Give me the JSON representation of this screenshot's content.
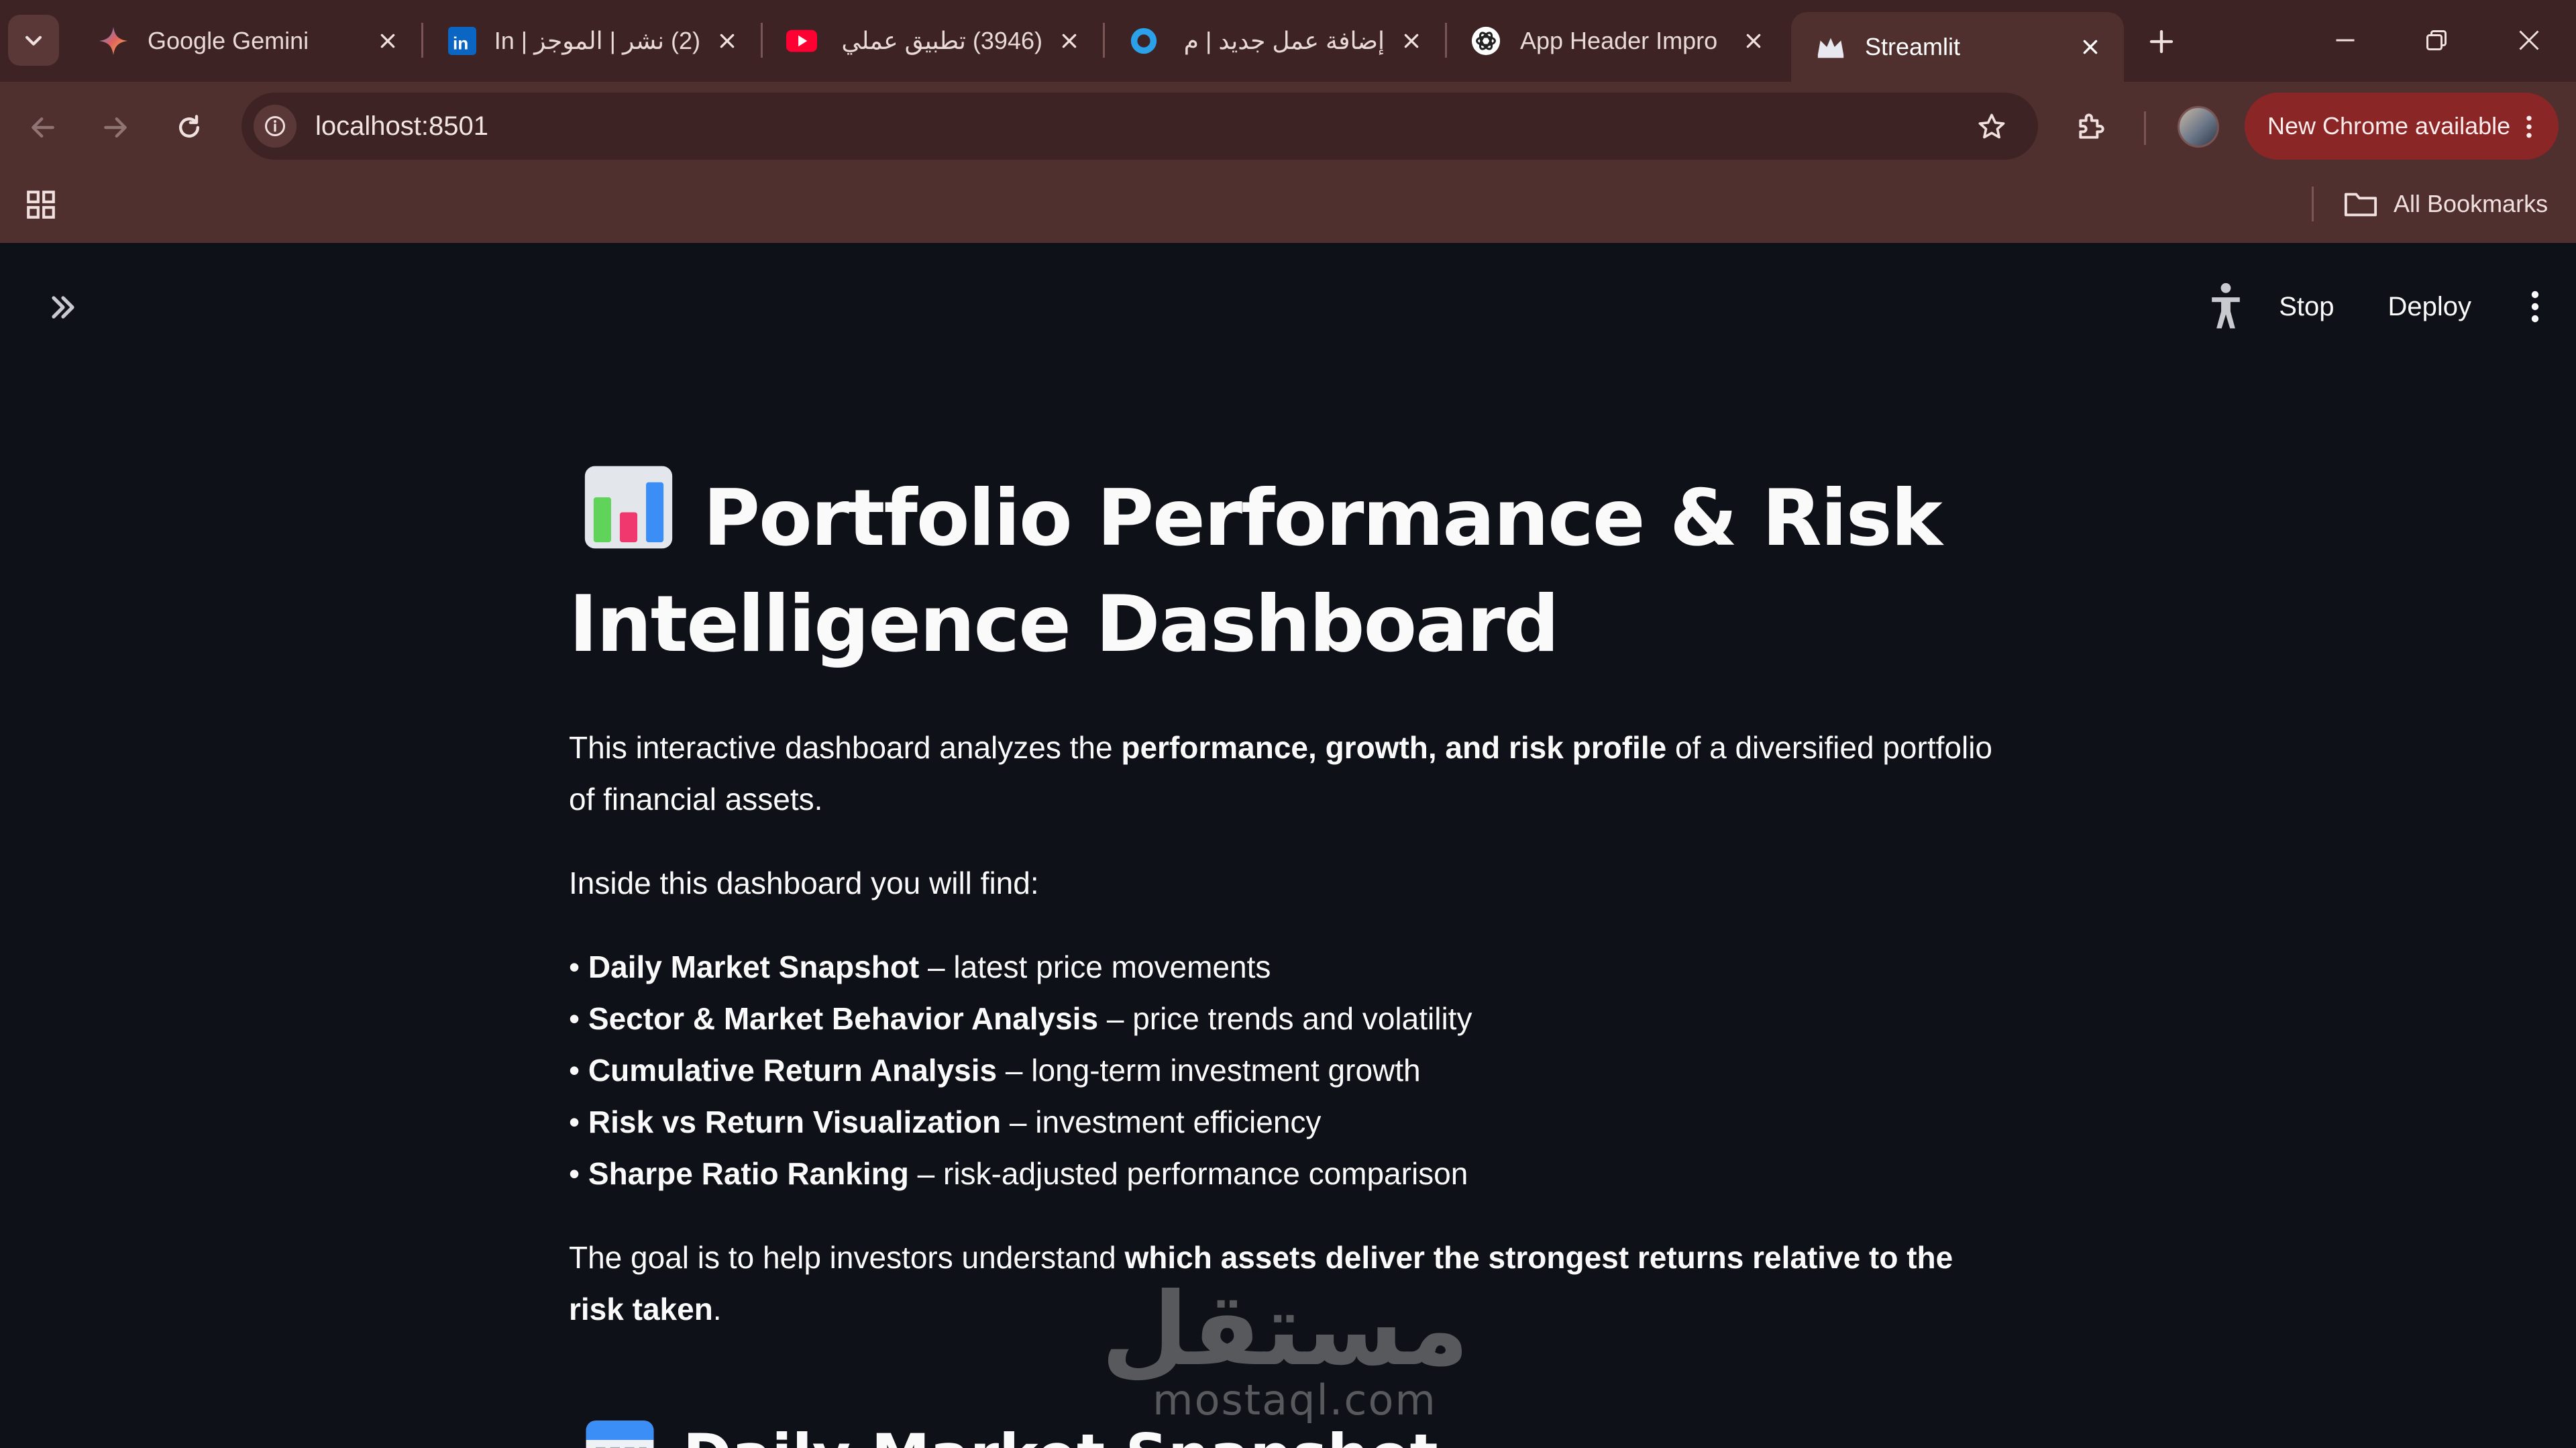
{
  "browser": {
    "tabs": [
      {
        "title": "Google Gemini",
        "icon": "gemini-icon"
      },
      {
        "title": "(2) نشر | الموجز | In",
        "icon": "linkedin-icon"
      },
      {
        "title": "(3946) تطبيق عملي",
        "icon": "youtube-icon"
      },
      {
        "title": "إضافة عمل جديد | م",
        "icon": "circle-icon"
      },
      {
        "title": "App Header Impro",
        "icon": "chatgpt-icon"
      },
      {
        "title": "Streamlit",
        "icon": "streamlit-crown-icon"
      }
    ],
    "active_tab_index": 5,
    "url": "localhost:8501",
    "update_label": "New Chrome available",
    "bookmarks_label": "All Bookmarks"
  },
  "streamlit": {
    "header": {
      "stop_label": "Stop",
      "deploy_label": "Deploy"
    }
  },
  "page": {
    "title": "Portfolio Performance & Risk Intelligence Dashboard",
    "intro": {
      "before": "This interactive dashboard analyzes the ",
      "bold": "performance, growth, and risk profile",
      "after": " of a diversified portfolio of financial assets."
    },
    "inside_text": "Inside this dashboard you will find:",
    "features": [
      {
        "bullet": "• ",
        "name": "Daily Market Snapshot",
        "desc": " – latest price movements"
      },
      {
        "bullet": "• ",
        "name": "Sector & Market Behavior Analysis",
        "desc": " – price trends and volatility"
      },
      {
        "bullet": "• ",
        "name": "Cumulative Return Analysis",
        "desc": " – long-term investment growth"
      },
      {
        "bullet": "• ",
        "name": "Risk vs Return Visualization",
        "desc": " – investment efficiency"
      },
      {
        "bullet": "• ",
        "name": "Sharpe Ratio Ranking",
        "desc": " – risk-adjusted performance comparison"
      }
    ],
    "goal": {
      "before": "The goal is to help investors understand ",
      "bold": "which assets deliver the strongest returns relative to the risk taken",
      "after": "."
    },
    "section_title": "Daily Market Snapshot"
  },
  "watermark": {
    "arabic": "مستقل",
    "latin": "mostaql.com"
  },
  "colors": {
    "tab_strip": "#3d2324",
    "toolbar": "#50302f",
    "update_button": "#8b2627",
    "app_background": "#0e1117",
    "text": "#fafafa"
  }
}
